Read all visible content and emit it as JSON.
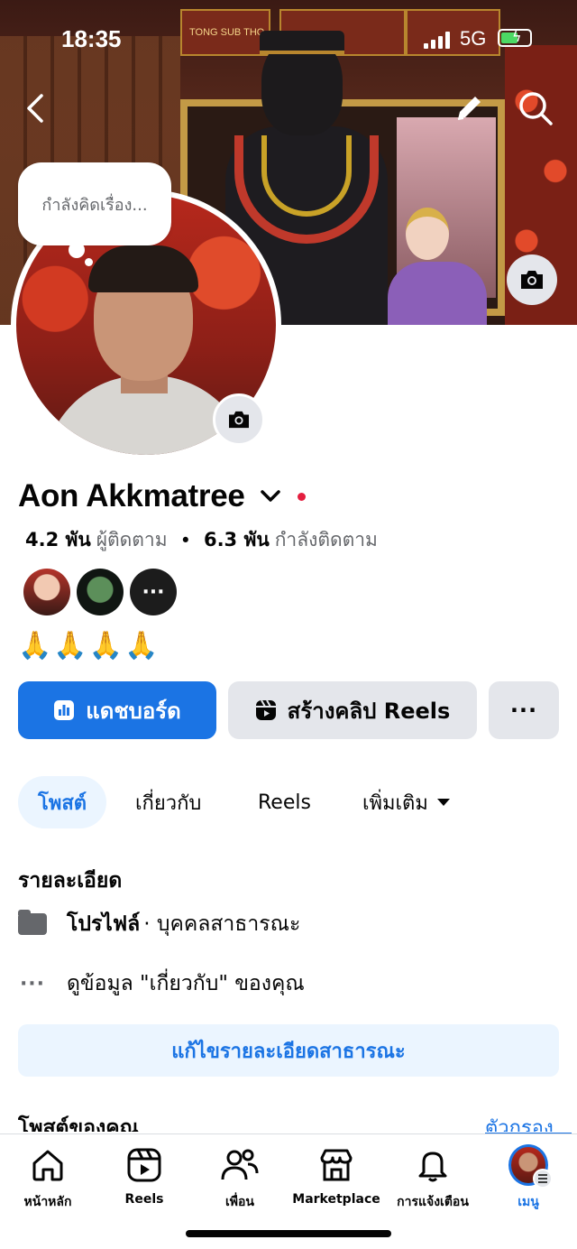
{
  "status_bar": {
    "time": "18:35",
    "network": "5G"
  },
  "cover": {
    "sign_1": "TONG SUB THO"
  },
  "thought_bubble": {
    "placeholder": "กำลังคิดเรื่อง..."
  },
  "profile": {
    "name": "Aon Akkmatree",
    "followers_count": "4.2 พัน",
    "followers_label": "ผู้ติดตาม",
    "following_count": "6.3 พัน",
    "following_label": "กำลังติดตาม",
    "separator": "•",
    "bio": "🙏🙏🙏🙏",
    "friends_more": "···"
  },
  "actions": {
    "dashboard_label": "แดชบอร์ด",
    "create_reels_label": "สร้างคลิป Reels",
    "more_label": "···"
  },
  "tabs": [
    {
      "label": "โพสต์",
      "active": true
    },
    {
      "label": "เกี่ยวกับ",
      "active": false
    },
    {
      "label": "Reels",
      "active": false
    },
    {
      "label": "เพิ่มเติม",
      "active": false
    }
  ],
  "details": {
    "title": "รายละเอียด",
    "profile_type_label": "โปรไฟล์",
    "profile_type_value": "· บุคคลสาธารณะ",
    "about_link": "ดูข้อมูล \"เกี่ยวกับ\" ของคุณ",
    "edit_public_label": "แก้ไขรายละเอียดสาธารณะ"
  },
  "posts": {
    "title": "โพสต์ของคุณ",
    "filter_label": "ตัวกรอง"
  },
  "bottom_nav": [
    {
      "label": "หน้าหลัก",
      "icon": "home-icon",
      "active": false
    },
    {
      "label": "Reels",
      "icon": "reels-icon",
      "active": false
    },
    {
      "label": "เพื่อน",
      "icon": "friends-icon",
      "active": false
    },
    {
      "label": "Marketplace",
      "icon": "marketplace-icon",
      "active": false
    },
    {
      "label": "การแจ้งเตือน",
      "icon": "bell-icon",
      "active": false
    },
    {
      "label": "เมนู",
      "icon": "menu-avatar",
      "active": true
    }
  ],
  "colors": {
    "accent": "#1b74e4",
    "accent_light": "#ebf5ff",
    "button_grey": "#e4e6eb",
    "text_primary": "#050505",
    "text_secondary": "#65676b",
    "online_dot": "#e41e3f"
  }
}
